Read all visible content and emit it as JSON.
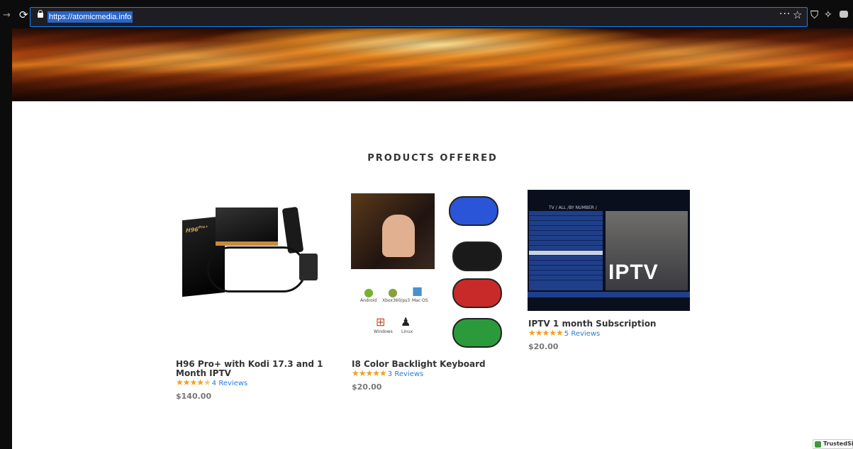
{
  "browser": {
    "url": "https://atomicmedia.info",
    "icons": [
      "back-arrow-icon",
      "reload-icon",
      "lock-icon",
      "more-options-icon",
      "star-icon",
      "shield-icon",
      "extension-icon",
      "sync-icon"
    ]
  },
  "section": {
    "title": "PRODUCTS OFFERED"
  },
  "products": [
    {
      "title": "H96 Pro+ with Kodi 17.3 and 1 Month IPTV",
      "rating": 4.5,
      "reviews": "4 Reviews",
      "price": "$140.00",
      "box_label": "H96",
      "box_label_sup": "Pro+"
    },
    {
      "title": "I8 Color Backlight Keyboard",
      "rating": 5,
      "reviews": "3 Reviews",
      "price": "$20.00",
      "os_labels": [
        "Android",
        "Xbox360/ps3",
        "Mac OS",
        "Windows",
        "Linux"
      ]
    },
    {
      "title": "IPTV 1 month Subscription",
      "rating": 5,
      "reviews": "5 Reviews",
      "price": "$20.00",
      "screen_text": "IPTV",
      "screen_header": "TV / ALL /BY NUMBER /"
    }
  ],
  "badge": {
    "text": "TrustedSite"
  },
  "colors": {
    "accent": "#0a84ff",
    "star": "#f0a020",
    "link": "#2d7bd8",
    "price": "#777777"
  }
}
